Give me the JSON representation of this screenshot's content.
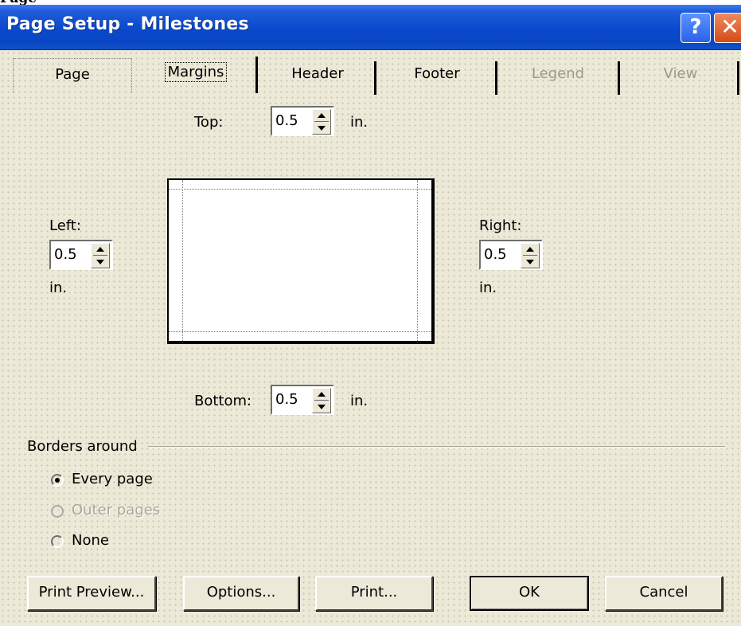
{
  "window": {
    "title": "Page Setup - Milestones",
    "top_strip_text": "Page",
    "help_label": "?",
    "close_label": "✕"
  },
  "tabs": [
    {
      "label": "Page",
      "state": "normal"
    },
    {
      "label": "Margins",
      "state": "selected"
    },
    {
      "label": "Header",
      "state": "normal"
    },
    {
      "label": "Footer",
      "state": "normal"
    },
    {
      "label": "Legend",
      "state": "disabled"
    },
    {
      "label": "View",
      "state": "disabled"
    }
  ],
  "margins": {
    "top": {
      "label": "Top:",
      "value": "0.5",
      "unit": "in."
    },
    "left": {
      "label": "Left:",
      "value": "0.5",
      "unit": "in."
    },
    "right": {
      "label": "Right:",
      "value": "0.5",
      "unit": "in."
    },
    "bottom": {
      "label": "Bottom:",
      "value": "0.5",
      "unit": "in."
    }
  },
  "borders": {
    "group_label": "Borders around",
    "options": [
      {
        "label": "Every page",
        "checked": true,
        "enabled": true
      },
      {
        "label": "Outer pages",
        "checked": false,
        "enabled": false
      },
      {
        "label": "None",
        "checked": false,
        "enabled": true
      }
    ]
  },
  "buttons": {
    "print_preview": "Print Preview...",
    "options": "Options...",
    "print": "Print...",
    "ok": "OK",
    "cancel": "Cancel"
  }
}
